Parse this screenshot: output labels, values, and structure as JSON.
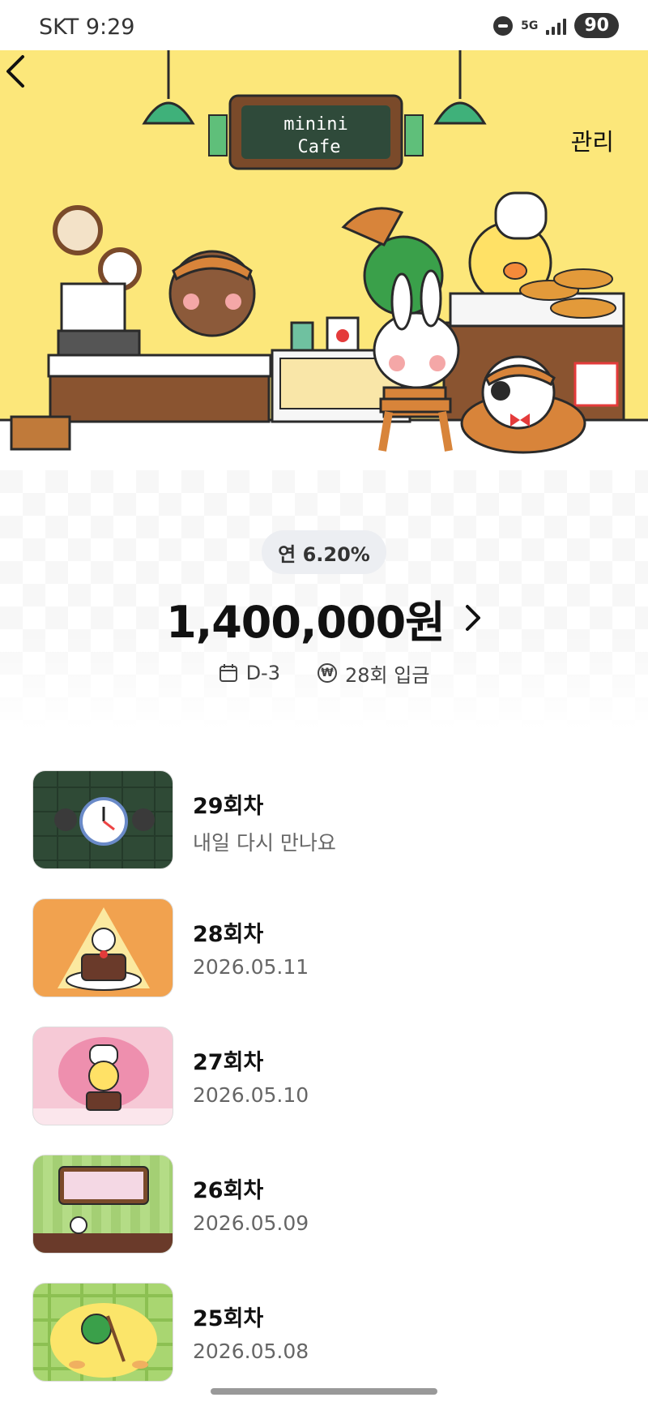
{
  "status_bar": {
    "carrier_time": "SKT 9:29",
    "network": "5G",
    "battery": "90"
  },
  "header": {
    "manage_label": "관리",
    "sign_title_line1": "minini",
    "sign_title_line2": "Cafe"
  },
  "summary": {
    "rate_label": "연 6.20%",
    "amount": "1,400,000원",
    "dday": "D-3",
    "deposit_count": "28회 입금"
  },
  "installments": [
    {
      "title": "29회차",
      "subtitle": "내일 다시 만나요",
      "thumb": "clock"
    },
    {
      "title": "28회차",
      "subtitle": "2026.05.11",
      "thumb": "cake-orange"
    },
    {
      "title": "27회차",
      "subtitle": "2026.05.10",
      "thumb": "cake-pink"
    },
    {
      "title": "26회차",
      "subtitle": "2026.05.09",
      "thumb": "shop-green"
    },
    {
      "title": "25회차",
      "subtitle": "2026.05.08",
      "thumb": "sweep-yellow"
    }
  ],
  "colors": {
    "hero_bg": "#FCE77A",
    "pill_bg": "#ECEEF2",
    "subtitle": "#666666"
  }
}
